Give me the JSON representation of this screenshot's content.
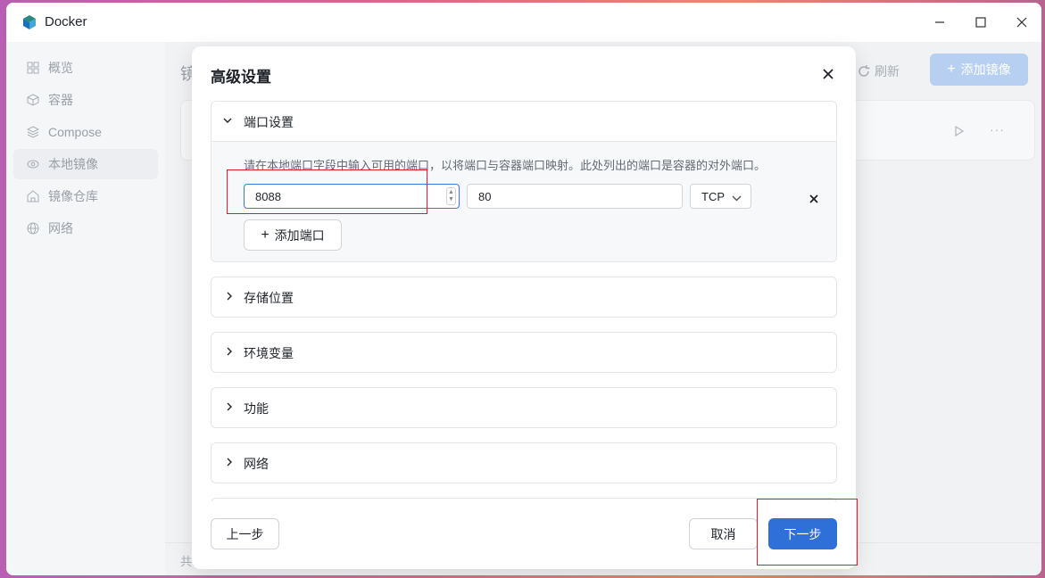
{
  "window": {
    "title": "Docker"
  },
  "sidebar": {
    "items": [
      {
        "label": "概览",
        "icon": "grid-icon"
      },
      {
        "label": "容器",
        "icon": "cube-icon"
      },
      {
        "label": "Compose",
        "icon": "layers-icon"
      },
      {
        "label": "本地镜像",
        "icon": "eye-icon",
        "active": true
      },
      {
        "label": "镜像仓库",
        "icon": "home-icon"
      },
      {
        "label": "网络",
        "icon": "globe-icon"
      }
    ]
  },
  "main": {
    "title_partial": "镜",
    "refresh_label": "刷新",
    "add_image_label": "添加镜像",
    "footer_partial": "共"
  },
  "modal": {
    "title": "高级设置",
    "sections": {
      "ports": {
        "label": "端口设置",
        "expanded": true
      },
      "storage": {
        "label": "存储位置"
      },
      "env": {
        "label": "环境变量"
      },
      "features": {
        "label": "功能"
      },
      "network": {
        "label": "网络"
      }
    },
    "ports_hint": "请在本地端口字段中输入可用的端口，以将端口与容器端口映射。此处列出的端口是容器的对外端口。",
    "port_row": {
      "local_port": "8088",
      "container_port": "80",
      "protocol": "TCP"
    },
    "add_port_label": "添加端口",
    "buttons": {
      "prev": "上一步",
      "cancel": "取消",
      "next": "下一步"
    }
  },
  "colors": {
    "primary": "#2f6fd8",
    "highlight": "#d9202a",
    "add_image_disabled": "#b7d0f2"
  }
}
